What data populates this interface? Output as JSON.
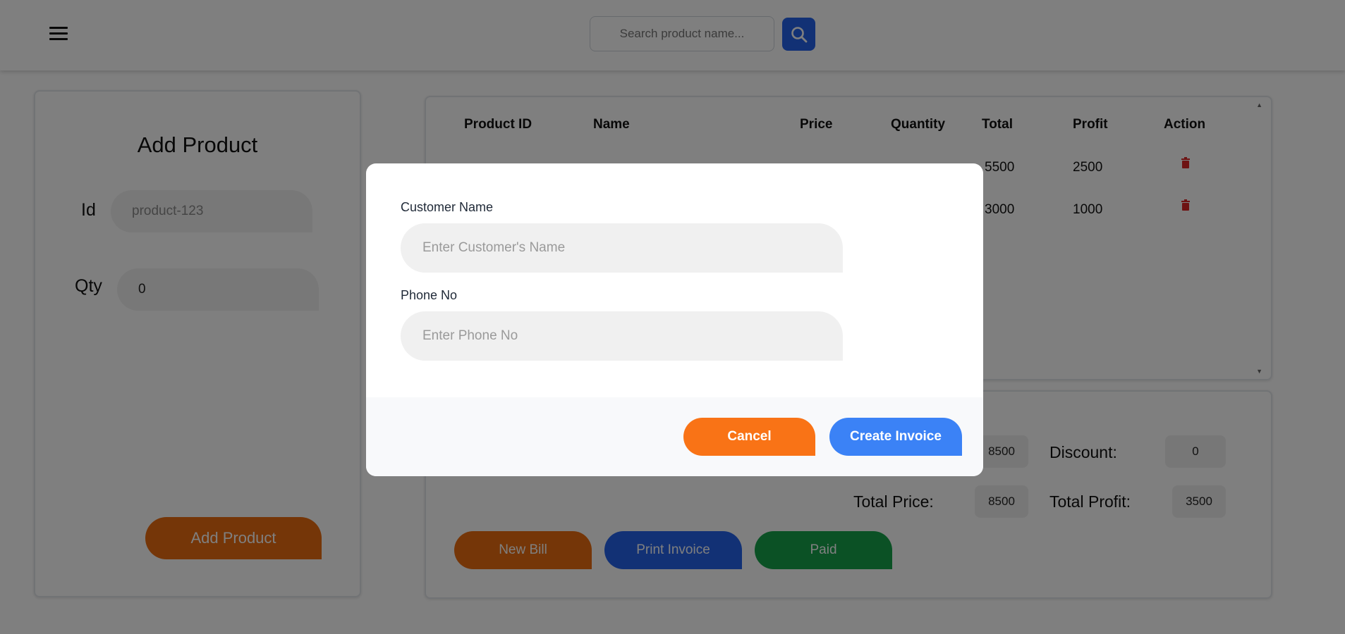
{
  "search": {
    "placeholder": "Search product name..."
  },
  "add_product": {
    "title": "Add Product",
    "id_label": "Id",
    "id_placeholder": "product-123",
    "qty_label": "Qty",
    "qty_value": "0",
    "button_label": "Add Product"
  },
  "table": {
    "headers": [
      "Product ID",
      "Name",
      "Price",
      "Quantity",
      "Total",
      "Profit",
      "Action"
    ],
    "rows": [
      {
        "total": "5500",
        "profit": "2500"
      },
      {
        "total": "3000",
        "profit": "1000"
      }
    ]
  },
  "summary": {
    "subtotal_value": "8500",
    "discount_label": "Discount:",
    "discount_value": "0",
    "total_price_label": "Total Price:",
    "total_price_value": "8500",
    "total_profit_label": "Total Profit:",
    "total_profit_value": "3500"
  },
  "buttons": {
    "new_bill": "New Bill",
    "print_invoice": "Print Invoice",
    "paid": "Paid"
  },
  "modal": {
    "customer_label": "Customer Name",
    "customer_placeholder": "Enter Customer's Name",
    "phone_label": "Phone No",
    "phone_placeholder": "Enter Phone No",
    "cancel": "Cancel",
    "create": "Create Invoice"
  },
  "colors": {
    "primary_blue": "#2563eb",
    "accent_orange": "#ea6c10",
    "paid_green": "#16a34a",
    "delete_red": "#dc2626",
    "create_blue": "#3b82f6",
    "cancel_orange": "#f97316"
  },
  "icons": {
    "menu": "menu-icon",
    "search": "search-icon",
    "delete": "trash-icon"
  }
}
